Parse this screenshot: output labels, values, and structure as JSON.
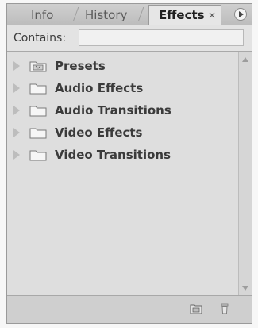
{
  "tabs": {
    "info": "Info",
    "history": "History",
    "effects": "Effects",
    "effects_close": "×"
  },
  "search": {
    "label": "Contains:",
    "value": "",
    "placeholder": ""
  },
  "tree": {
    "items": [
      {
        "label": "Presets",
        "icon": "presets-folder-icon"
      },
      {
        "label": "Audio Effects",
        "icon": "folder-icon"
      },
      {
        "label": "Audio Transitions",
        "icon": "folder-icon"
      },
      {
        "label": "Video Effects",
        "icon": "folder-icon"
      },
      {
        "label": "Video Transitions",
        "icon": "folder-icon"
      }
    ]
  },
  "footer": {
    "new_bin_icon": "new-custom-bin-icon",
    "delete_icon": "trash-icon"
  }
}
